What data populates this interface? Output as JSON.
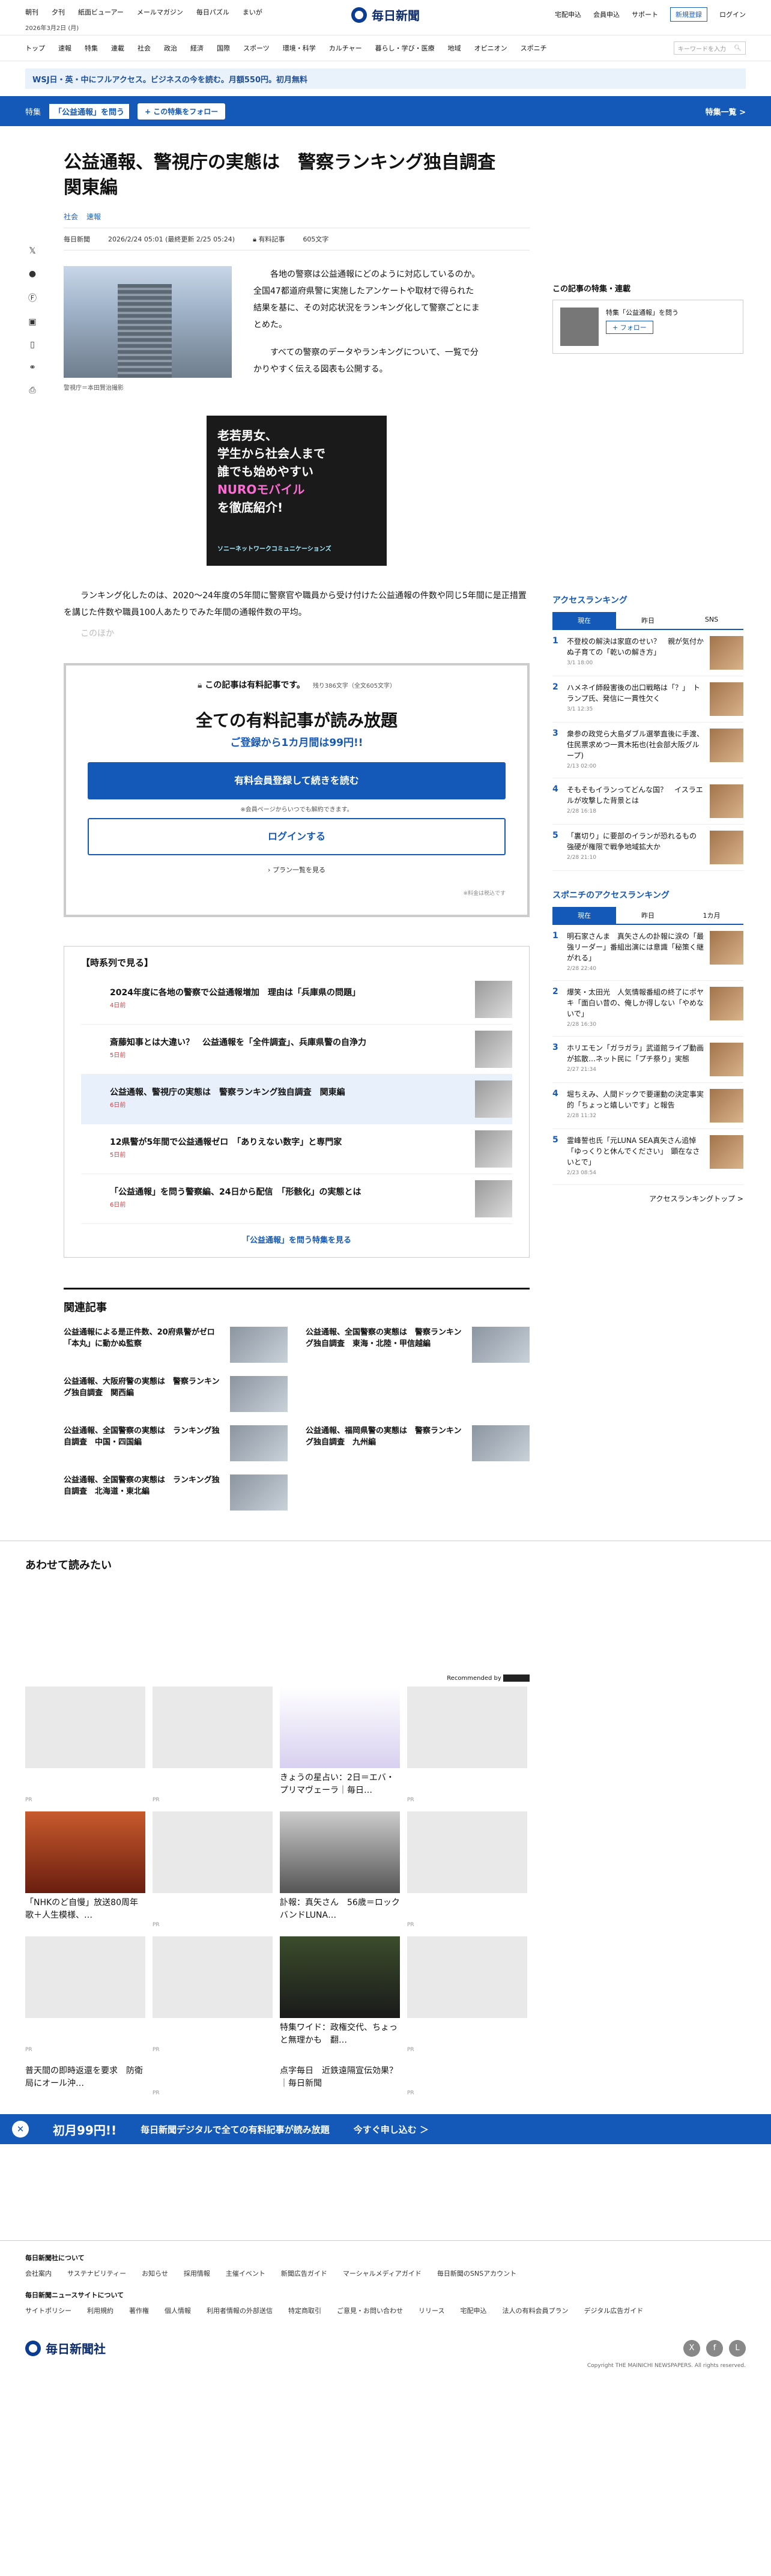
{
  "header": {
    "links": [
      "朝刊",
      "夕刊",
      "紙面ビューアー",
      "メールマガジン",
      "毎日パズル",
      "まいが"
    ],
    "date": "2026年3月2日 (月)",
    "logo": "毎日新聞",
    "right": [
      "宅配申込",
      "会員申込",
      "サポート"
    ],
    "register": "新規登録",
    "login": "ログイン"
  },
  "nav": {
    "items": [
      "トップ",
      "速報",
      "特集",
      "連載",
      "社会",
      "政治",
      "経済",
      "国際",
      "スポーツ",
      "環境・科学",
      "カルチャー",
      "暮らし・学び・医療",
      "地域",
      "オピニオン",
      "スポニチ"
    ],
    "search_placeholder": "キーワードを入力"
  },
  "promo": "WSJ日・英・中にフルアクセス。ビジネスの今を読む。月額550円。初月無料",
  "special": {
    "label": "特集",
    "tag": "「公益通報」を問う",
    "follow": "+ この特集をフォロー",
    "list": "特集一覧 >"
  },
  "share": [
    "X",
    "comment",
    "facebook",
    "bookmark",
    "save",
    "link",
    "print"
  ],
  "article": {
    "title": "公益通報、警視庁の実態は　警察ランキング独自調査　関東編",
    "categories": [
      "社会",
      "速報"
    ],
    "author": "毎日新聞",
    "date": "2026/2/24 05:01 (最終更新 2/25 05:24)",
    "type": "有料記事",
    "chars": "605文字",
    "caption": "警視庁＝本田賢治撮影",
    "lead": [
      "各地の警察は公益通報にどのように対応しているのか。全国47都道府県警に実施したアンケートや取材で得られた結果を基に、その対応状況をランキング化して警察ごとにまとめた。",
      "すべての警察のデータやランキングについて、一覧で分かりやすく伝える図表も公開する。"
    ],
    "body": "ランキング化したのは、2020～24年度の5年間に警察官や職員から受け付けた公益通報の件数や同じ5年間に是正措置を講じた件数や職員100人あたりでみた年間の通報件数の平均。",
    "fade": "このほか"
  },
  "ad": {
    "line1": "老若男女、",
    "line2": "学生から社会人まで",
    "line3": "誰でも始めやすい",
    "brand": "NUROモバイル",
    "line4": "を徹底紹介!",
    "foot": "ソニーネットワークコミュニケーションズ"
  },
  "paywall": {
    "lock": "この記事は有料記事です。",
    "remaining": "残り386文字（全文605文字）",
    "headline": "全ての有料記事が読み放題",
    "sub": "ご登録から1カ月間は99円!!",
    "register": "有料会員登録して続きを読む",
    "note": "※会員ページからいつでも解約できます。",
    "login": "ログインする",
    "plans": "› プラン一覧を見る",
    "print": "※料金は税込です"
  },
  "timeline": {
    "title": "【時系列で見る】",
    "items": [
      {
        "text": "2024年度に各地の警察で公益通報増加　理由は「兵庫県の問題」",
        "date": "4日前"
      },
      {
        "text": "斎藤知事とは大違い？　公益通報を「全件調査」、兵庫県警の自浄力",
        "date": "5日前"
      },
      {
        "text": "公益通報、警視庁の実態は　警察ランキング独自調査　関東編",
        "date": "6日前"
      },
      {
        "text": "12県警が5年間で公益通報ゼロ　「ありえない数字」と専門家",
        "date": "5日前"
      },
      {
        "text": "「公益通報」を問う警察編、24日から配信　「形骸化」の実態とは",
        "date": "6日前"
      }
    ],
    "more": "「公益通報」を問う特集を見る"
  },
  "related": {
    "title": "関連記事",
    "items": [
      "公益通報による是正件数、20府県警がゼロ　「本丸」に動かぬ監察",
      "公益通報、全国警察の実態は　警察ランキング独自調査　東海・北陸・甲信越編",
      "公益通報、大阪府警の実態は　警察ランキング独自調査　関西編",
      "",
      "公益通報、全国警察の実態は　ランキング独自調査　中国・四国編",
      "公益通報、福岡県警の実態は　警察ランキング独自調査　九州編",
      "公益通報、全国警察の実態は　ランキング独自調査　北海道・東北編"
    ]
  },
  "side": {
    "feature_title": "この記事の特集・連載",
    "feature_label": "特集「公益通報」を問う",
    "feature_follow": "+ フォロー",
    "ranking_title": "アクセスランキング",
    "tabs": [
      "現在",
      "昨日",
      "SNS"
    ],
    "ranking": [
      {
        "text": "不登校の解決は家庭のせい？　親が気付かぬ子育ての「乾いの解き方」",
        "time": "3/1 18:00"
      },
      {
        "text": "ハメネイ師殺害後の出口戦略は「？」　トランプ氏、発信に一貫性欠く",
        "time": "3/1 12:35"
      },
      {
        "text": "衆参の政党ら大島ダブル選挙直後に手渡、住民票求めつ一貫木拓也(社会部大阪グループ)",
        "time": "2/13 02:00"
      },
      {
        "text": "そもそもイランってどんな国？　イスラエルが攻撃した背景とは",
        "time": "2/28 16:18"
      },
      {
        "text": "「裏切り」に要部のイランが恐れるもの　強硬が権限で戦争地域拡大か",
        "time": "2/28 21:10"
      }
    ],
    "sponichi_title": "スポニチのアクセスランキング",
    "sponichi_tabs": [
      "現在",
      "昨日",
      "1カ月"
    ],
    "sponichi": [
      {
        "text": "明石家さんま　真矢さんの訃報に涙の「最強リーダー」番組出演には意識「秘策く継がれる」",
        "time": "2/28 22:40"
      },
      {
        "text": "爆笑・太田光　人気情報番組の終了にポヤキ「面白い昔の、俺しか得しない「やめないで」",
        "time": "2/28 16:30"
      },
      {
        "text": "ホリエモン「ガラガラ」武道館ライブ動画が拡散…ネット民に「プチ祭り」実態",
        "time": "2/27 21:34"
      },
      {
        "text": "堀ちえみ、人間ドックで要運動の決定事実的「ちょっと嬉しいです」と報告",
        "time": "2/28 11:32"
      },
      {
        "text": "霊峰誓也氏「元LUNA SEA真矢さん追悼「ゆっくりと休んでください」　顕在なさいとで」",
        "time": "2/23 08:54"
      }
    ],
    "ranking_top": "アクセスランキングトップ >"
  },
  "readalso": {
    "title": "あわせて読みたい",
    "recommended": "Recommended by",
    "cards": [
      {
        "title": "",
        "pr": "PR"
      },
      {
        "title": "",
        "pr": "PR"
      },
      {
        "title": "きょうの星占い：2日＝エバ・プリマヴェーラ｜毎日…",
        "pr": ""
      },
      {
        "title": "",
        "pr": "PR"
      },
      {
        "title": "「NHKのど自慢」放送80周年　歌＋人生模様、…",
        "pr": ""
      },
      {
        "title": "",
        "pr": "PR"
      },
      {
        "title": "訃報：真矢さん　56歳＝ロックバンドLUNA…",
        "pr": ""
      },
      {
        "title": "",
        "pr": "PR"
      },
      {
        "title": "",
        "pr": "PR"
      },
      {
        "title": "",
        "pr": "PR"
      },
      {
        "title": "特集ワイド：政権交代、ちょっと無理かも　翻…",
        "pr": ""
      },
      {
        "title": "",
        "pr": "PR"
      },
      {
        "title": "普天間の即時返還を要求　防衛局にオール沖…",
        "pr": ""
      },
      {
        "title": "",
        "pr": "PR"
      },
      {
        "title": "点字毎日　近鉄遠隔宣伝効果？｜毎日新聞",
        "pr": ""
      },
      {
        "title": "",
        "pr": "PR"
      }
    ]
  },
  "banner": {
    "big": "初月99円!!",
    "text": "毎日新聞デジタルで全ての有料記事が読み放題",
    "cta": "今すぐ申し込む ＞"
  },
  "footer": {
    "about": "毎日新聞社について",
    "row1": [
      "会社案内",
      "サステナビリティー",
      "お知らせ",
      "採用情報",
      "主催イベント",
      "新聞広告ガイド",
      "マーシャルメディアガイド",
      "毎日新聞のSNSアカウント"
    ],
    "site_about": "毎日新聞ニュースサイトについて",
    "row2": [
      "サイトポリシー",
      "利用規約",
      "著作権",
      "個人情報",
      "利用者情報の外部送信",
      "特定商取引",
      "ご意見・お問い合わせ",
      "リリース",
      "宅配申込",
      "法人の有料会員プラン",
      "デジタル広告ガイド"
    ],
    "logo": "毎日新聞社",
    "copy": "Copyright THE MAINICHI NEWSPAPERS. All rights reserved."
  }
}
